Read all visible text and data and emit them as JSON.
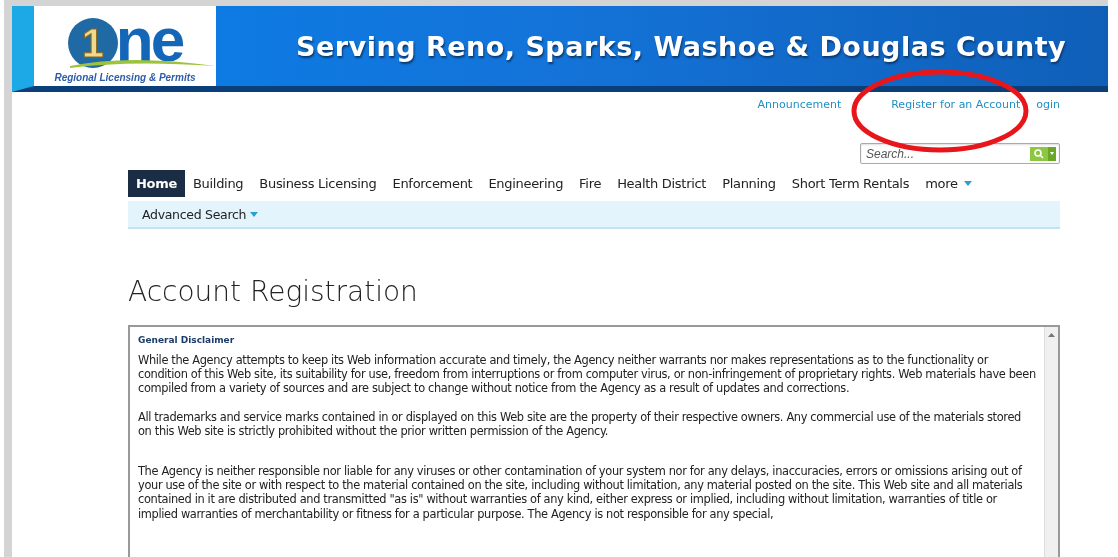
{
  "header": {
    "logo": {
      "digit": "1",
      "letters": "ne",
      "tagline": "Regional Licensing & Permits"
    },
    "title": "Serving Reno, Sparks, Washoe & Douglas County"
  },
  "top_links": [
    "Announcement",
    "Register for an Account",
    "ogin"
  ],
  "search": {
    "placeholder": "Search..."
  },
  "nav": {
    "tabs": [
      {
        "label": "Home",
        "selected": true
      },
      {
        "label": "Building",
        "selected": false
      },
      {
        "label": "Business Licensing",
        "selected": false
      },
      {
        "label": "Enforcement",
        "selected": false
      },
      {
        "label": "Engineering",
        "selected": false
      },
      {
        "label": "Fire",
        "selected": false
      },
      {
        "label": "Health District",
        "selected": false
      },
      {
        "label": "Planning",
        "selected": false
      },
      {
        "label": "Short Term Rentals",
        "selected": false
      },
      {
        "label": "more",
        "selected": false,
        "kind": "dropdown"
      }
    ],
    "sub_items": [
      "Advanced Search"
    ]
  },
  "page_title": "Account Registration",
  "disclaimer": {
    "heading": "General Disclaimer",
    "paragraphs": [
      "While the Agency attempts to keep its Web information accurate and timely, the Agency neither warrants nor makes representations as to the functionality or condition of this Web site, its suitability for use, freedom from interruptions or from computer virus, or non-infringement of proprietary rights. Web materials have been compiled from a variety of sources and are subject to change without notice from the Agency as a result of updates and corrections.",
      "All trademarks and service marks contained in or displayed on this Web site are the property of their respective owners. Any commercial use of the materials stored on this Web site is strictly prohibited without the prior written permission of the Agency.",
      "The Agency is neither responsible nor liable for any viruses or other contamination of your system nor for any delays, inaccuracies, errors or omissions arising out of your use of the site or with respect to the material contained on the site, including without limitation, any material posted on the site. This Web site and all materials contained in it are distributed and transmitted \"as is\" without warranties of any kind, either express or implied, including without limitation, warranties of title or implied warranties of merchantability or fitness for a particular purpose. The Agency is not responsible for any special,"
    ]
  },
  "annotation": {
    "kind": "ellipse"
  }
}
